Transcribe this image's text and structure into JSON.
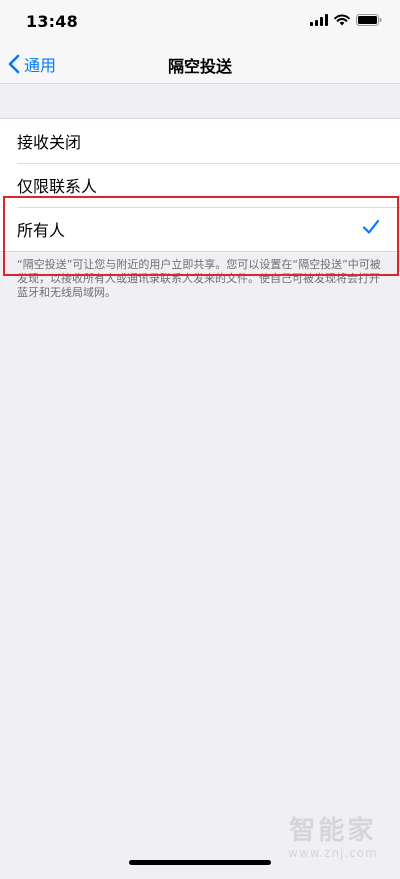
{
  "status_bar": {
    "time": "13:48",
    "icons": [
      "signal-icon",
      "wifi-icon",
      "battery-icon"
    ]
  },
  "nav": {
    "back_label": "通用",
    "title": "隔空投送"
  },
  "options": [
    {
      "label": "接收关闭",
      "selected": false
    },
    {
      "label": "仅限联系人",
      "selected": false
    },
    {
      "label": "所有人",
      "selected": true
    }
  ],
  "footer_note": "“隔空投送”可让您与附近的用户立即共享。您可以设置在“隔空投送”中可被发现，以接收所有人或通讯录联系人发来的文件。使自己可被发现将会打开蓝牙和无线局域网。",
  "watermark": {
    "title": "智能家",
    "url": "www.znj.com"
  },
  "colors": {
    "accent": "#007aff",
    "highlight_box": "#e0242b",
    "background": "#efeff4"
  }
}
